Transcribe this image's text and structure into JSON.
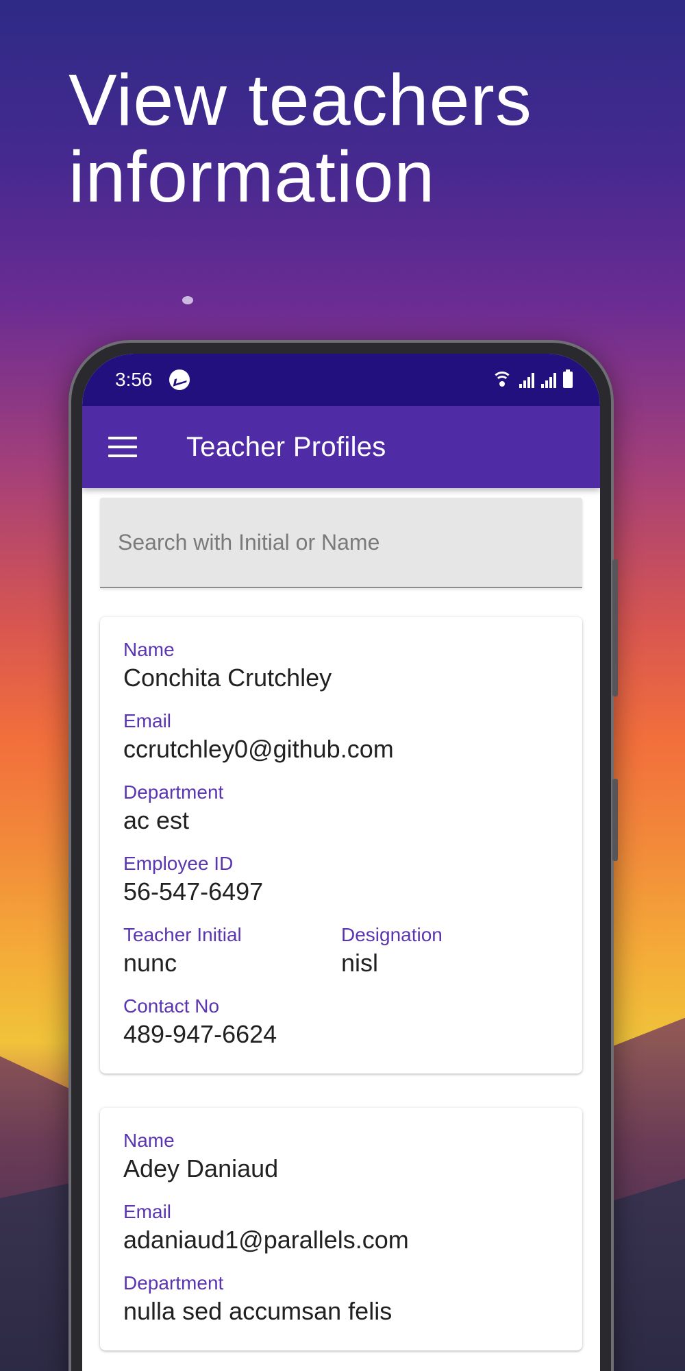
{
  "headline": "View teachers information",
  "status_bar": {
    "time": "3:56"
  },
  "app_bar": {
    "title": "Teacher Profiles"
  },
  "search": {
    "placeholder": "Search with Initial or Name"
  },
  "labels": {
    "name": "Name",
    "email": "Email",
    "department": "Department",
    "employee_id": "Employee ID",
    "teacher_initial": "Teacher Initial",
    "designation": "Designation",
    "contact_no": "Contact No"
  },
  "teachers": [
    {
      "name": "Conchita Crutchley",
      "email": "ccrutchley0@github.com",
      "department": "ac est",
      "employee_id": "56-547-6497",
      "teacher_initial": "nunc",
      "designation": "nisl",
      "contact_no": "489-947-6624"
    },
    {
      "name": "Adey Daniaud",
      "email": "adaniaud1@parallels.com",
      "department": "nulla sed accumsan felis"
    }
  ],
  "colors": {
    "status_bar": "#22107e",
    "app_bar": "#4f2ca6",
    "label": "#5b35b0"
  },
  "icons": [
    "messenger-icon",
    "wifi-icon",
    "signal-icon",
    "battery-icon",
    "menu-icon"
  ]
}
